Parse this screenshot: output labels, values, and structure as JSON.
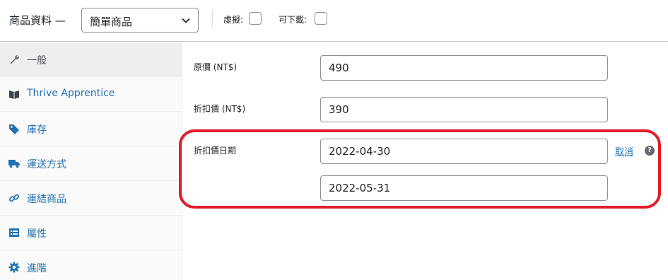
{
  "header": {
    "title": "商品資料 —",
    "product_type": "簡單商品",
    "virtual_label": "虛擬:",
    "downloadable_label": "可下載:"
  },
  "sidebar": {
    "items": [
      {
        "label": "一般",
        "icon": "wrench-icon",
        "active": true
      },
      {
        "label": "Thrive Apprentice",
        "icon": "book-icon"
      },
      {
        "label": "庫存",
        "icon": "tag-icon"
      },
      {
        "label": "運送方式",
        "icon": "truck-icon"
      },
      {
        "label": "連結商品",
        "icon": "link-icon"
      },
      {
        "label": "屬性",
        "icon": "list-icon"
      },
      {
        "label": "進階",
        "icon": "gear-icon"
      }
    ]
  },
  "fields": {
    "regular_price": {
      "label": "原價 (NT$)",
      "value": "490"
    },
    "sale_price": {
      "label": "折扣價 (NT$)",
      "value": "390"
    },
    "sale_dates": {
      "label": "折扣價日期",
      "from": "2022-04-30",
      "to": "2022-05-31",
      "cancel_label": "取消",
      "help": "?"
    }
  },
  "colors": {
    "link": "#2271b1",
    "highlight": "#e01e2b",
    "active_bg": "#eeeeee"
  }
}
